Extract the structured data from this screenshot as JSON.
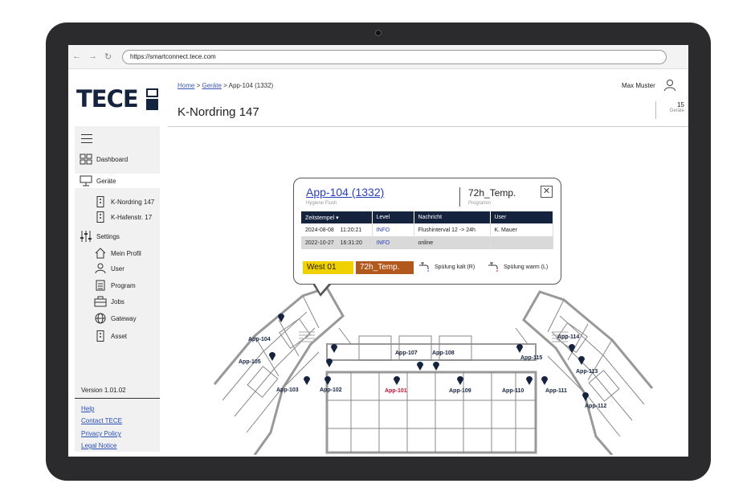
{
  "browser": {
    "url": "https://smartconnect.tece.com",
    "back_glyph": "←",
    "forward_glyph": "→",
    "reload_glyph": "↻"
  },
  "brand": {
    "logo_text": "TECE"
  },
  "sidebar": {
    "items": [
      {
        "label": "Dashboard",
        "icon": "dashboard-icon"
      },
      {
        "label": "Geräte",
        "icon": "devices-icon"
      },
      {
        "label": "K-Nordring 147",
        "icon": "device-icon"
      },
      {
        "label": "K-Hafenstr. 17",
        "icon": "device-icon"
      },
      {
        "label": "Settings",
        "icon": "sliders-icon"
      },
      {
        "label": "Mein Profil",
        "icon": "home-icon"
      },
      {
        "label": "User",
        "icon": "user-icon"
      },
      {
        "label": "Program",
        "icon": "clipboard-icon"
      },
      {
        "label": "Jobs",
        "icon": "briefcase-icon"
      },
      {
        "label": "Gateway",
        "icon": "globe-icon"
      },
      {
        "label": "Asset",
        "icon": "device-icon"
      }
    ],
    "version": "Version 1.01.02",
    "links": [
      "Help",
      "Contact TECE",
      "Privacy Policy",
      "Legal Notice"
    ]
  },
  "header": {
    "breadcrumb": {
      "home": "Home",
      "sep1": " > ",
      "devices": "Geräte",
      "sep2": " > App-104 (1332)"
    },
    "title": "K-Nordring 147",
    "user_name": "Max Muster",
    "device_count": "15",
    "device_count_label": "Geräte"
  },
  "popup": {
    "title": "App-104 (1332)",
    "subtitle": "Hygiene Flush",
    "program": "72h_Temp.",
    "program_label": "Programm",
    "close_glyph": "✕",
    "table": {
      "headers": [
        "Zeitstempel ▾",
        "Level",
        "Nachricht",
        "User"
      ],
      "rows": [
        {
          "date": "2024-08-08",
          "time": "11:20:21",
          "level": "INFO",
          "message": "Flushinterval 12 -> 24h",
          "user": "K. Mauer"
        },
        {
          "date": "2022-10-27",
          "time": "16:31:20",
          "level": "INFO",
          "message": "online",
          "user": ""
        }
      ]
    },
    "zone": "West 01",
    "program_tag": "72h_Temp.",
    "flush_cold": "Spülung kalt (R)",
    "flush_warm": "Spülung warm (L)"
  },
  "apartments": [
    {
      "label": "App-104"
    },
    {
      "label": "App-105"
    },
    {
      "label": "App-103"
    },
    {
      "label": "App-102"
    },
    {
      "label": "App-101"
    },
    {
      "label": "App-107"
    },
    {
      "label": "App-108"
    },
    {
      "label": "App-109"
    },
    {
      "label": "App-110"
    },
    {
      "label": "App-111"
    },
    {
      "label": "App-112"
    },
    {
      "label": "App-113"
    },
    {
      "label": "App-114"
    },
    {
      "label": "App-115"
    }
  ],
  "colors": {
    "brand_navy": "#16233f",
    "link_blue": "#2a3fbf",
    "zone_yellow": "#f1d000",
    "program_orange": "#b3581d",
    "alert_red": "#c8102e"
  }
}
